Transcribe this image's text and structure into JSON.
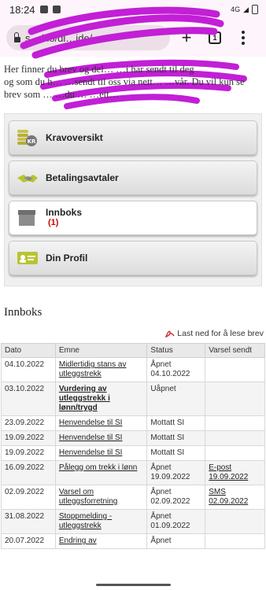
{
  "status_bar": {
    "time": "18:24",
    "network": "4G"
  },
  "browser": {
    "url": "s…/no/di…ide/",
    "tab_count": "1",
    "new_tab_label": "+"
  },
  "intro": {
    "line1": "Her finner du brev og del…                      …i har sendt til deg",
    "line2": "og som du h…    …sendt til oss via nett…           …vår. Du vil kun se",
    "line3": "brev som …        …du …  …ett…"
  },
  "menu": [
    {
      "label": "Kravoversikt",
      "icon": "coins-kr-icon"
    },
    {
      "label": "Betalingsavtaler",
      "icon": "handshake-icon"
    },
    {
      "label": "Innboks",
      "count": "(1)",
      "icon": "inbox-box-icon",
      "active": true
    },
    {
      "label": "Din Profil",
      "icon": "profile-card-icon"
    }
  ],
  "inbox": {
    "heading": "Innboks",
    "download_label": "Last ned for å lese brev",
    "columns": [
      "Dato",
      "Emne",
      "Status",
      "Varsel sendt"
    ],
    "rows": [
      {
        "date": "04.10.2022",
        "subject": "Midlertidig stans av utleggstrekk",
        "status": "Åpnet 04.10.2022",
        "notice": "",
        "bold": false
      },
      {
        "date": "03.10.2022",
        "subject": "Vurdering av utleggstrekk i lønn/trygd",
        "status": "Uåpnet",
        "notice": "",
        "bold": true
      },
      {
        "date": "23.09.2022",
        "subject": "Henvendelse til SI",
        "status": "Mottatt SI",
        "notice": "",
        "bold": false
      },
      {
        "date": "19.09.2022",
        "subject": "Henvendelse til SI",
        "status": "Mottatt SI",
        "notice": "",
        "bold": false
      },
      {
        "date": "19.09.2022",
        "subject": "Henvendelse til SI",
        "status": "Mottatt SI",
        "notice": "",
        "bold": false
      },
      {
        "date": "16.09.2022",
        "subject": "Pålegg om trekk i lønn",
        "status": "Åpnet 19.09.2022",
        "notice": "E-post 19.09.2022",
        "bold": false
      },
      {
        "date": "02.09.2022",
        "subject": "Varsel om utleggsforretning",
        "status": "Åpnet 02.09.2022",
        "notice": "SMS 02.09.2022",
        "bold": false
      },
      {
        "date": "31.08.2022",
        "subject": "Stoppmelding - utleggstrekk",
        "status": "Åpnet 01.09.2022",
        "notice": "",
        "bold": false
      },
      {
        "date": "20.07.2022",
        "subject": "Endring av",
        "status": "Åpnet",
        "notice": "",
        "bold": false
      }
    ]
  },
  "colors": {
    "accent_red": "#d00000",
    "scribble": "#c21fd6",
    "menu_bg": "#f0f0f0"
  }
}
